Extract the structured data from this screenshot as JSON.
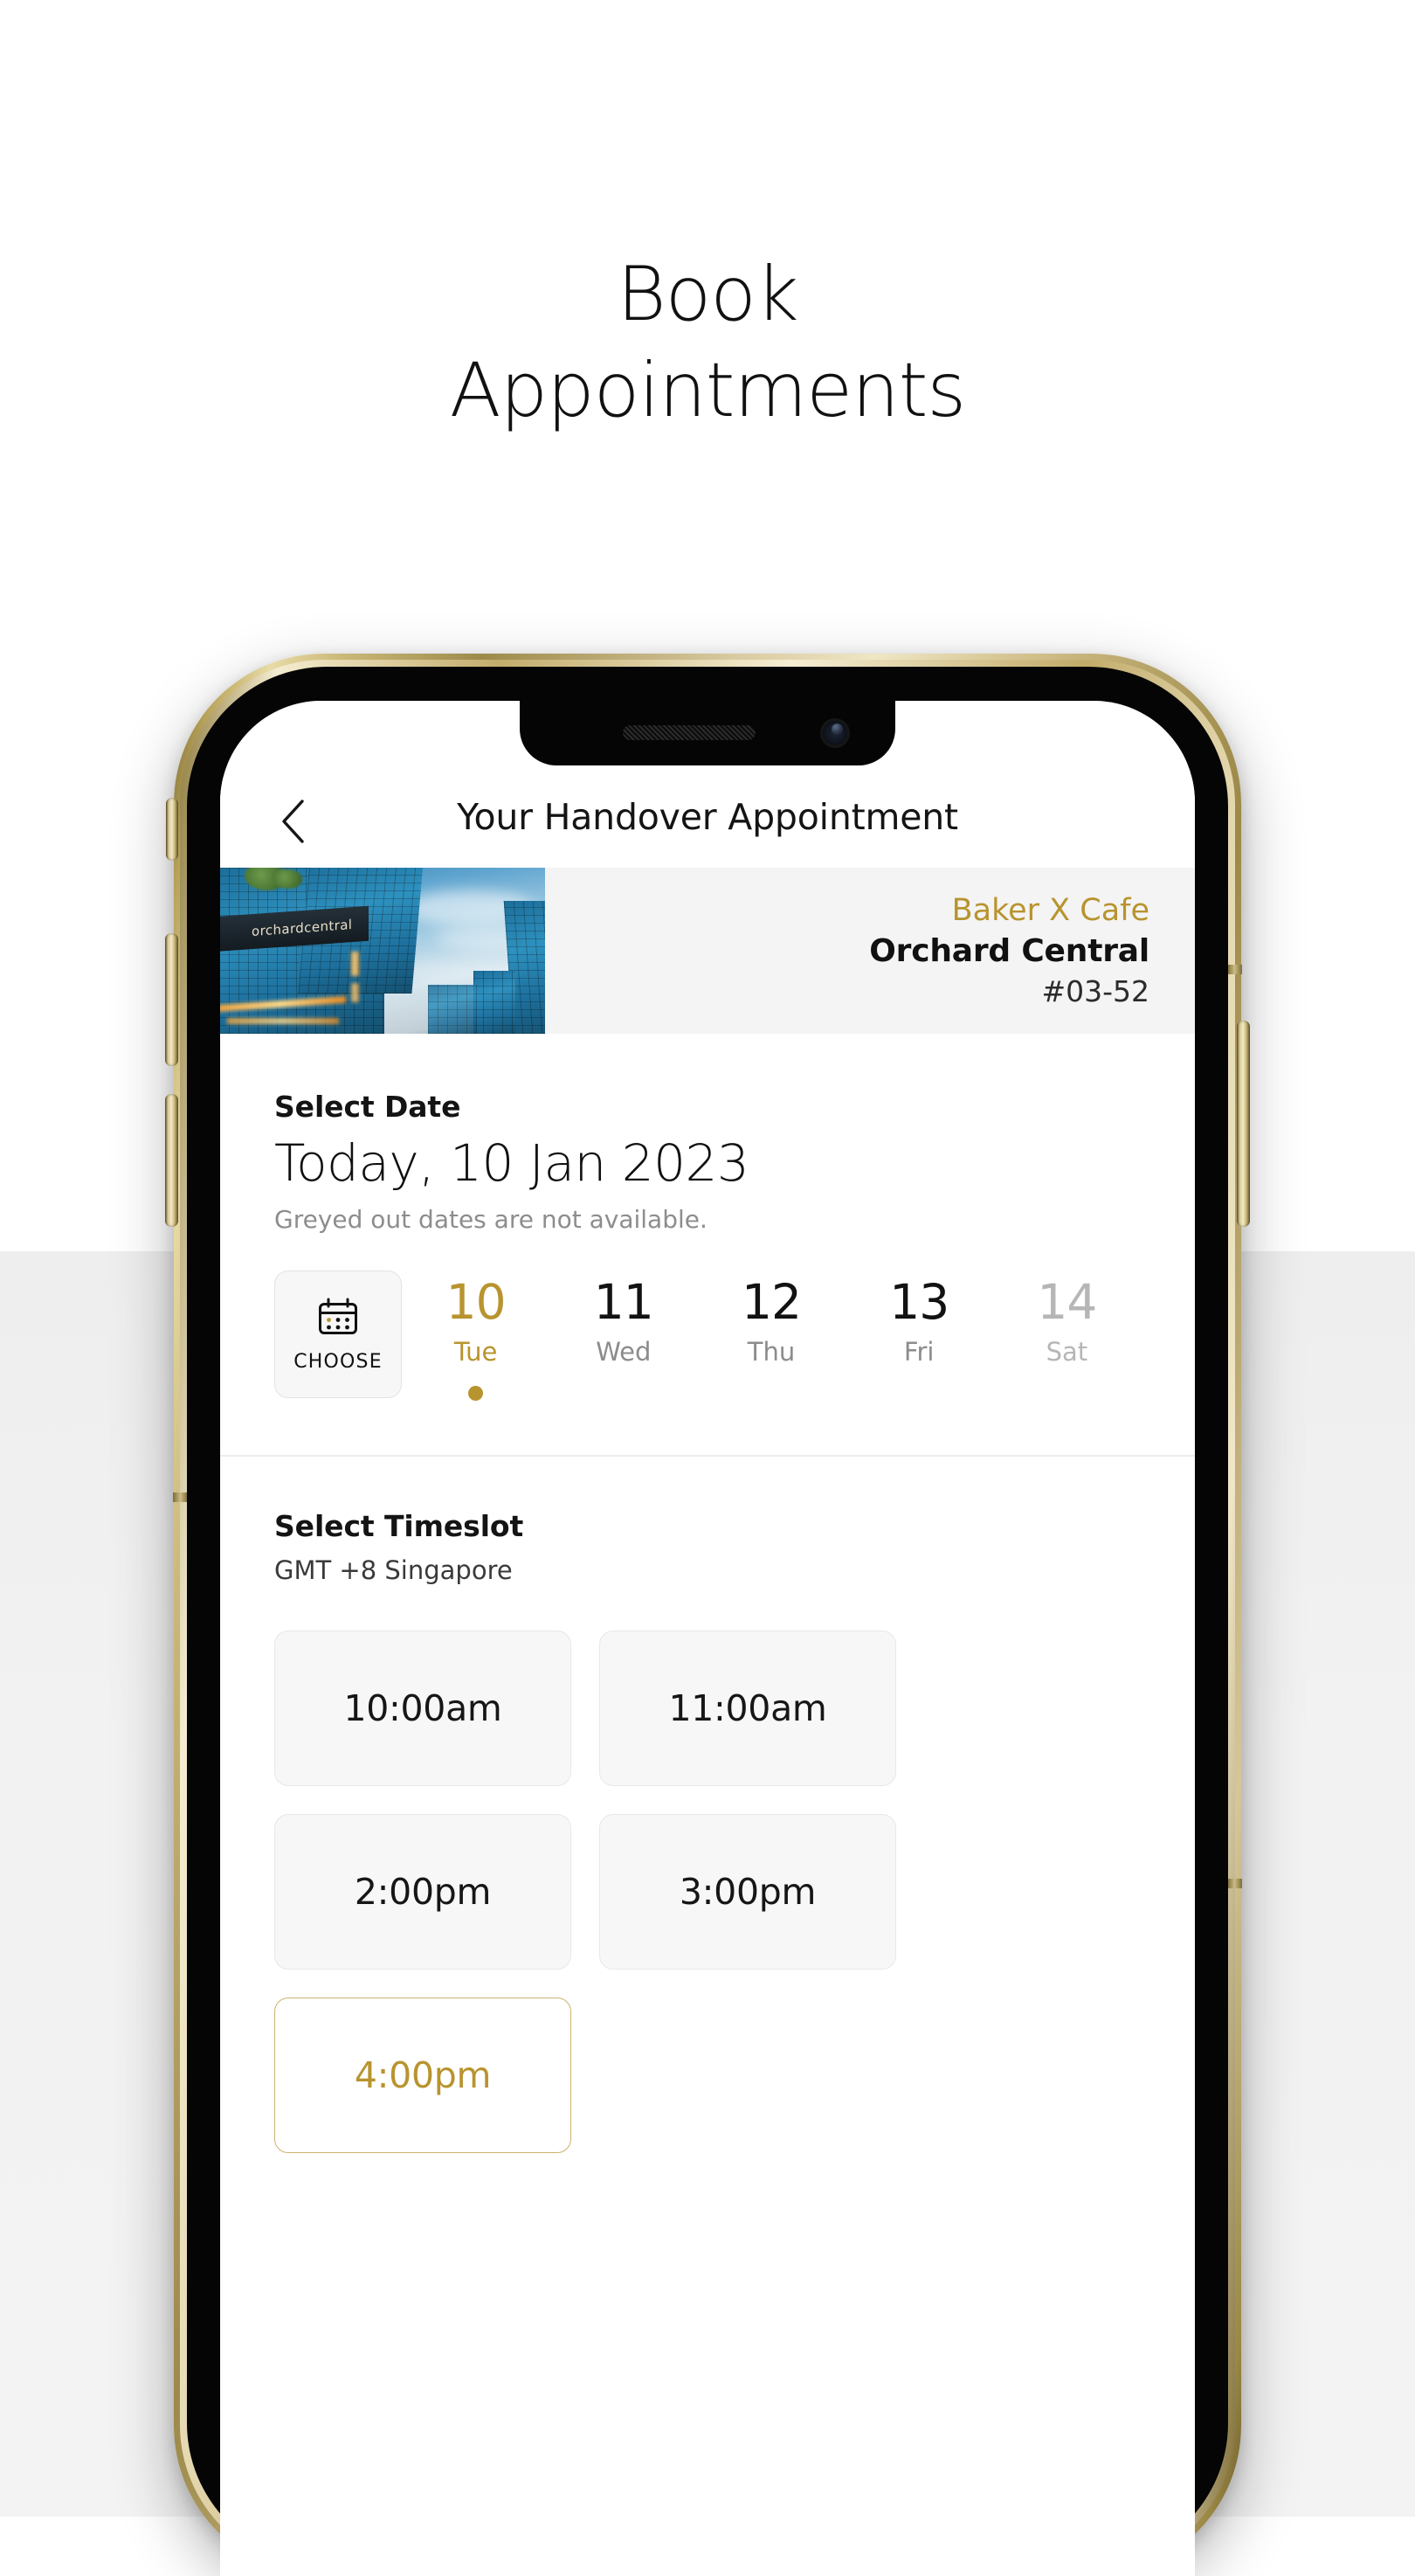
{
  "page": {
    "headline": "Book\nAppointments"
  },
  "app": {
    "back_icon": "chevron-left-icon",
    "title": "Your Handover Appointment"
  },
  "venue": {
    "photo_alt": "orchardcentral",
    "sign_text": "orchardcentral",
    "brand": "Baker X Cafe",
    "name": "Orchard Central",
    "unit": "#03-52"
  },
  "date_section": {
    "label": "Select Date",
    "selected_date": "Today, 10 Jan 2023",
    "note": "Greyed out dates are not available.",
    "choose_button": {
      "label": "CHOOSE",
      "icon": "calendar-icon"
    },
    "days": [
      {
        "num": "10",
        "name": "Tue",
        "state": "selected"
      },
      {
        "num": "11",
        "name": "Wed",
        "state": "available"
      },
      {
        "num": "12",
        "name": "Thu",
        "state": "available"
      },
      {
        "num": "13",
        "name": "Fri",
        "state": "available"
      },
      {
        "num": "14",
        "name": "Sat",
        "state": "unavailable"
      }
    ]
  },
  "timeslot_section": {
    "label": "Select Timeslot",
    "timezone": "GMT +8 Singapore",
    "slots": [
      {
        "label": "10:00am",
        "state": "available"
      },
      {
        "label": "11:00am",
        "state": "available"
      },
      {
        "label": "2:00pm",
        "state": "available"
      },
      {
        "label": "3:00pm",
        "state": "available"
      },
      {
        "label": "4:00pm",
        "state": "selected"
      }
    ]
  },
  "colors": {
    "gold": "#b8942f",
    "gold_border": "#cdb171",
    "text_dark": "#141414",
    "text_muted": "#8c8c8c",
    "text_disabled": "#b6b6b6",
    "chip_bg": "#f7f7f7",
    "card_bg": "#f4f4f4",
    "page_bg": "#ffffff"
  }
}
